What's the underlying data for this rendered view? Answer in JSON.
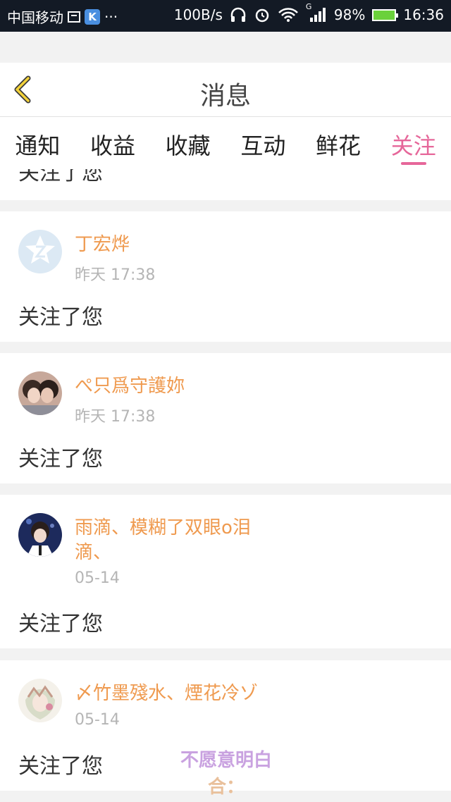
{
  "statusbar": {
    "carrier": "中国移动",
    "k_icon": "K",
    "dots": "···",
    "speed": "100B/s",
    "network": "G",
    "battery": "98%",
    "time": "16:36"
  },
  "header": {
    "title": "消息"
  },
  "tabs": [
    {
      "label": "通知",
      "active": false
    },
    {
      "label": "收益",
      "active": false
    },
    {
      "label": "收藏",
      "active": false
    },
    {
      "label": "互动",
      "active": false
    },
    {
      "label": "鲜花",
      "active": false
    },
    {
      "label": "关注",
      "active": true
    }
  ],
  "feed": {
    "partial_message": "关注了您",
    "items": [
      {
        "name": "丁宏烨",
        "time": "昨天 17:38",
        "message": "关注了您",
        "avatar": "default-avatar-icon"
      },
      {
        "name": "ぺ只爲守護妳",
        "time": "昨天 17:38",
        "message": "关注了您",
        "avatar": "user-photo"
      },
      {
        "name_line1": "雨滴、模糊了双眼o泪",
        "name_line2": "滴、",
        "time": "05-14",
        "message": "关注了您",
        "avatar": "user-photo"
      },
      {
        "name": "〆竹墨殘水、煙花冷ゾ",
        "time": "05-14",
        "message": "关注了您",
        "avatar": "user-photo"
      }
    ]
  },
  "overlay": {
    "line1": "不愿意明白",
    "line2": "合："
  },
  "colors": {
    "accent": "#e6679a",
    "username": "#ef9a4f",
    "statusbar": "#131a25"
  }
}
